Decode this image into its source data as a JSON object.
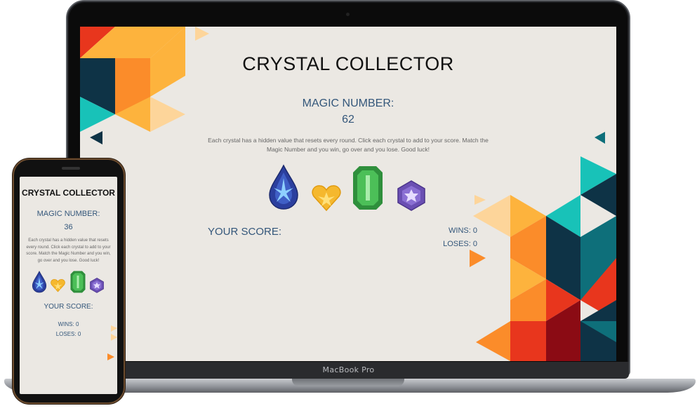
{
  "laptop": {
    "brand": "MacBook Pro",
    "app": {
      "title": "CRYSTAL COLLECTOR",
      "magic_label": "MAGIC NUMBER:",
      "magic_value": "62",
      "description": "Each crystal has a hidden value that resets every round. Click each crystal to add to your score. Match the Magic Number and you win, go over and you lose. Good luck!",
      "score_label": "YOUR SCORE:",
      "wins": "WINS: 0",
      "loses": "LOSES: 0"
    }
  },
  "phone": {
    "app": {
      "title": "CRYSTAL COLLECTOR",
      "magic_label": "MAGIC NUMBER:",
      "magic_value": "36",
      "description": "Each crystal has a hidden value that resets every round. Click each crystal to add to your score. Match the Magic Number and you win, go over and you lose. Good luck!",
      "score_label": "YOUR SCORE:",
      "wins": "WINS: 0",
      "loses: ": null,
      "loses": "LOSES: 0"
    }
  },
  "crystals": [
    {
      "name": "blue-teardrop-crystal-icon",
      "color": "#2b3f9e"
    },
    {
      "name": "yellow-heart-crystal-icon",
      "color": "#f5b82e"
    },
    {
      "name": "green-emerald-crystal-icon",
      "color": "#3aa346"
    },
    {
      "name": "purple-hexagon-crystal-icon",
      "color": "#6a4fb3"
    }
  ],
  "colors": {
    "background": "#ebe8e3",
    "heading_blue": "#33567a",
    "orange": "#fb8c2a",
    "yellow": "#fdb33d",
    "teal": "#18c2b8",
    "dark_navy": "#0e3346",
    "red": "#e8361d",
    "maroon": "#8b0b14"
  }
}
